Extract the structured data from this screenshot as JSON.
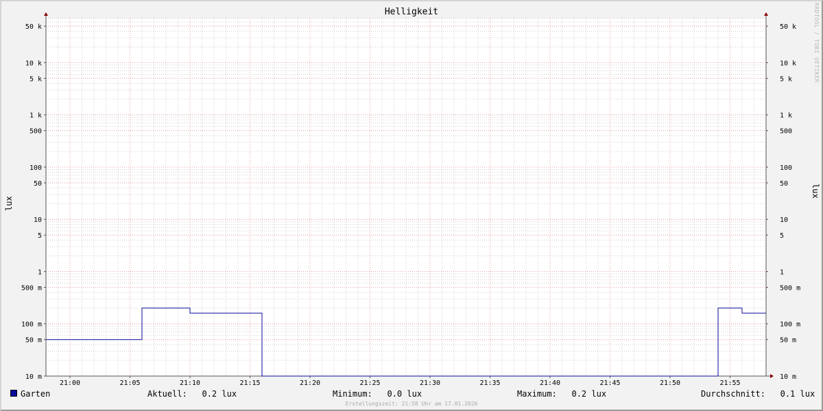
{
  "chart_data": {
    "type": "line",
    "title": "Helligkeit",
    "ylabel": "lux",
    "yscale": "log",
    "ylim": [
      0.01,
      70000
    ],
    "xlim": [
      "20:58",
      "21:58"
    ],
    "x_tick_labels": [
      "21:00",
      "21:05",
      "21:10",
      "21:15",
      "21:20",
      "21:25",
      "21:30",
      "21:35",
      "21:40",
      "21:45",
      "21:50",
      "21:55"
    ],
    "y_ticks": [
      {
        "value": 0.01,
        "label": "10 m"
      },
      {
        "value": 0.05,
        "label": "50 m"
      },
      {
        "value": 0.1,
        "label": "100 m"
      },
      {
        "value": 0.5,
        "label": "500 m"
      },
      {
        "value": 1,
        "label": "1"
      },
      {
        "value": 5,
        "label": "5"
      },
      {
        "value": 10,
        "label": "10"
      },
      {
        "value": 50,
        "label": "50"
      },
      {
        "value": 100,
        "label": "100"
      },
      {
        "value": 500,
        "label": "500"
      },
      {
        "value": 1000,
        "label": "1 k"
      },
      {
        "value": 5000,
        "label": "5 k"
      },
      {
        "value": 10000,
        "label": "10 k"
      },
      {
        "value": 50000,
        "label": "50 k"
      }
    ],
    "grid": true,
    "series": [
      {
        "name": "Garten",
        "color": "#0a0a9c",
        "step": true,
        "points": [
          {
            "x": "20:58",
            "y": 0.05
          },
          {
            "x": "21:06",
            "y": 0.2
          },
          {
            "x": "21:10",
            "y": 0.16
          },
          {
            "x": "21:16",
            "y": 0.01
          },
          {
            "x": "21:54",
            "y": 0.2
          },
          {
            "x": "21:56",
            "y": 0.16
          },
          {
            "x": "21:58",
            "y": 0.16
          }
        ]
      }
    ]
  },
  "legend": {
    "series_name": "Garten",
    "stats": [
      {
        "label": "Aktuell:",
        "value": "0.2 lux"
      },
      {
        "label": "Minimum:",
        "value": "0.0 lux"
      },
      {
        "label": "Maximum:",
        "value": "0.2 lux"
      },
      {
        "label": "Durchschnitt:",
        "value": "0.1 lux"
      }
    ]
  },
  "watermark": "RRDTOOL / TOBI OETIKER",
  "footer": "Erstellungszeit: 21:58 Uhr am 17.01.2026",
  "colors": {
    "background": "#f2f2f2",
    "canvas": "#ffffff",
    "major_grid": "#e6a0a0",
    "minor_grid": "#d0d0d0",
    "axis": "#555555",
    "arrow": "#8b0000"
  }
}
